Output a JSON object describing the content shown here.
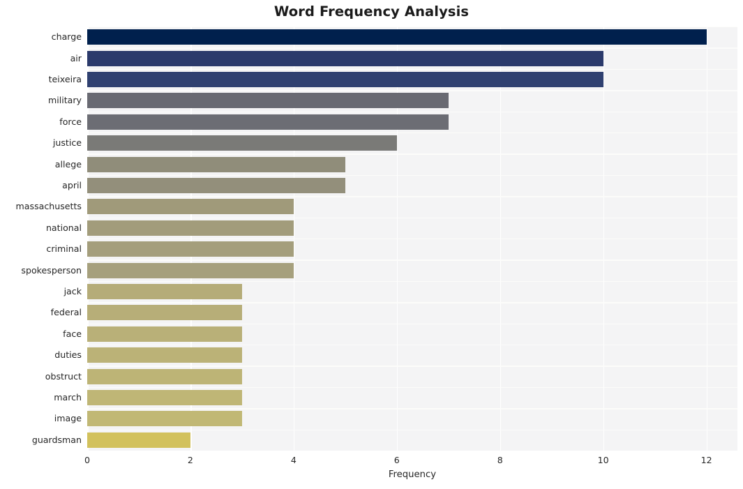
{
  "chart_data": {
    "type": "bar",
    "orientation": "horizontal",
    "title": "Word Frequency Analysis",
    "xlabel": "Frequency",
    "ylabel": "",
    "xlim": [
      0,
      12.6
    ],
    "ylim_categories": 20,
    "xticks": [
      0,
      2,
      4,
      6,
      8,
      10,
      12
    ],
    "xtick_labels": [
      "0",
      "2",
      "4",
      "6",
      "8",
      "10",
      "12"
    ],
    "grid": true,
    "grid_color": "#ffffff",
    "plot_background": "#f4f4f5",
    "figure_background": "#ffffff",
    "colormap": "cividis",
    "legend": null,
    "categories": [
      "charge",
      "air",
      "teixeira",
      "military",
      "force",
      "justice",
      "allege",
      "april",
      "massachusetts",
      "national",
      "criminal",
      "spokesperson",
      "jack",
      "federal",
      "face",
      "duties",
      "obstruct",
      "march",
      "image",
      "guardsman"
    ],
    "values": [
      12,
      10,
      10,
      7,
      7,
      6,
      5,
      5,
      4,
      4,
      4,
      4,
      3,
      3,
      3,
      3,
      3,
      3,
      3,
      2
    ],
    "bar_colors": [
      "#00204d",
      "#2b3a6b",
      "#2f4070",
      "#696a72",
      "#6c6d74",
      "#7a7a77",
      "#908d7a",
      "#938f7b",
      "#a09a7a",
      "#a29c7b",
      "#a49e7c",
      "#a6a07d",
      "#b5ac78",
      "#b7ae78",
      "#b9b078",
      "#bbb277",
      "#bdb476",
      "#bfb676",
      "#c1b875",
      "#d2c15c"
    ]
  }
}
